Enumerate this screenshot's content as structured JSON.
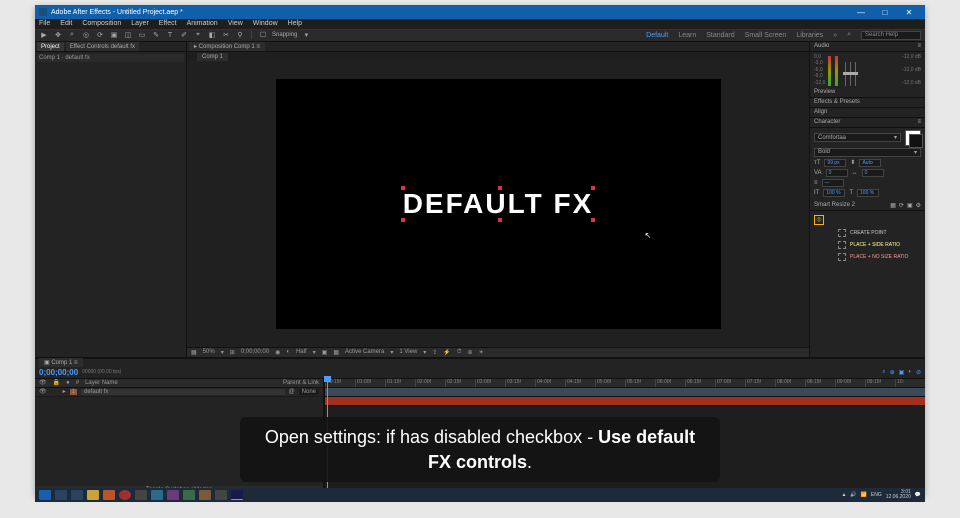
{
  "titlebar": {
    "title": "Adobe After Effects - Untitled Project.aep *"
  },
  "winbtns": {
    "min": "—",
    "max": "□",
    "close": "✕"
  },
  "menu": {
    "file": "File",
    "edit": "Edit",
    "composition": "Composition",
    "layer": "Layer",
    "effect": "Effect",
    "animation": "Animation",
    "view": "View",
    "window": "Window",
    "help": "Help"
  },
  "toolbar": {
    "snapping": "Snapping"
  },
  "workspace": {
    "default": "Default",
    "learn": "Learn",
    "standard": "Standard",
    "small": "Small Screen",
    "libraries": "Libraries",
    "search_ph": "Search Help"
  },
  "project": {
    "tab1": "Project",
    "tab2": "Effect Controls default fx",
    "item": "Comp 1 · default fx"
  },
  "comp": {
    "header": "Composition Comp 1",
    "tab": "Comp 1"
  },
  "canvas": {
    "text": "DEFAULT FX"
  },
  "footer": {
    "zoom": "50%",
    "time": "0;00;00;00",
    "res": "Half",
    "camera": "Active Camera",
    "views": "1 View"
  },
  "panels": {
    "audio": "Audio",
    "audio_labels": {
      "a": "0,0",
      "b": "-3,0",
      "c": "-6,0",
      "d": "-9,0",
      "e": "-12,0",
      "f": "-12,0 dB"
    },
    "preview": "Preview",
    "effects": "Effects & Presets",
    "align": "Align",
    "character": "Character",
    "smart": "Smart Resize 2"
  },
  "character": {
    "font": "Comfortaa",
    "weight": "Bold",
    "auto": "Auto",
    "size": "99 px",
    "kern": "0",
    "track": "0",
    "pct": "100 %",
    "pct2": "100 %"
  },
  "smart": {
    "create": "CREATE POINT",
    "place1": "PLACE + SIDE RATIO",
    "place2": "PLACE + NO SIZE RATIO"
  },
  "timeline": {
    "tab": "Comp 1",
    "timecode": "0;00;00;00",
    "frame": "00000 (00.00 fps)",
    "col_num": "#",
    "col_layer": "Layer Name",
    "col_parent": "Parent & Link",
    "row_layer": "default fx",
    "row_none": "None",
    "marks": [
      "00:15f",
      "01:00f",
      "01:15f",
      "02:00f",
      "02:15f",
      "03:00f",
      "03:15f",
      "04:00f",
      "04:15f",
      "05:00f",
      "05:15f",
      "06:00f",
      "06:15f",
      "07:00f",
      "07:15f",
      "08:00f",
      "08:15f",
      "09:00f",
      "09:15f",
      "10:"
    ],
    "footer": "Toggle Switches / Modes"
  },
  "caption": {
    "pre": "Open settings: if has disabled checkbox - ",
    "bold": "Use default FX controls",
    "post": "."
  },
  "taskbar": {
    "lang": "ENG",
    "time": "3:01",
    "date": "12.06.2020"
  }
}
